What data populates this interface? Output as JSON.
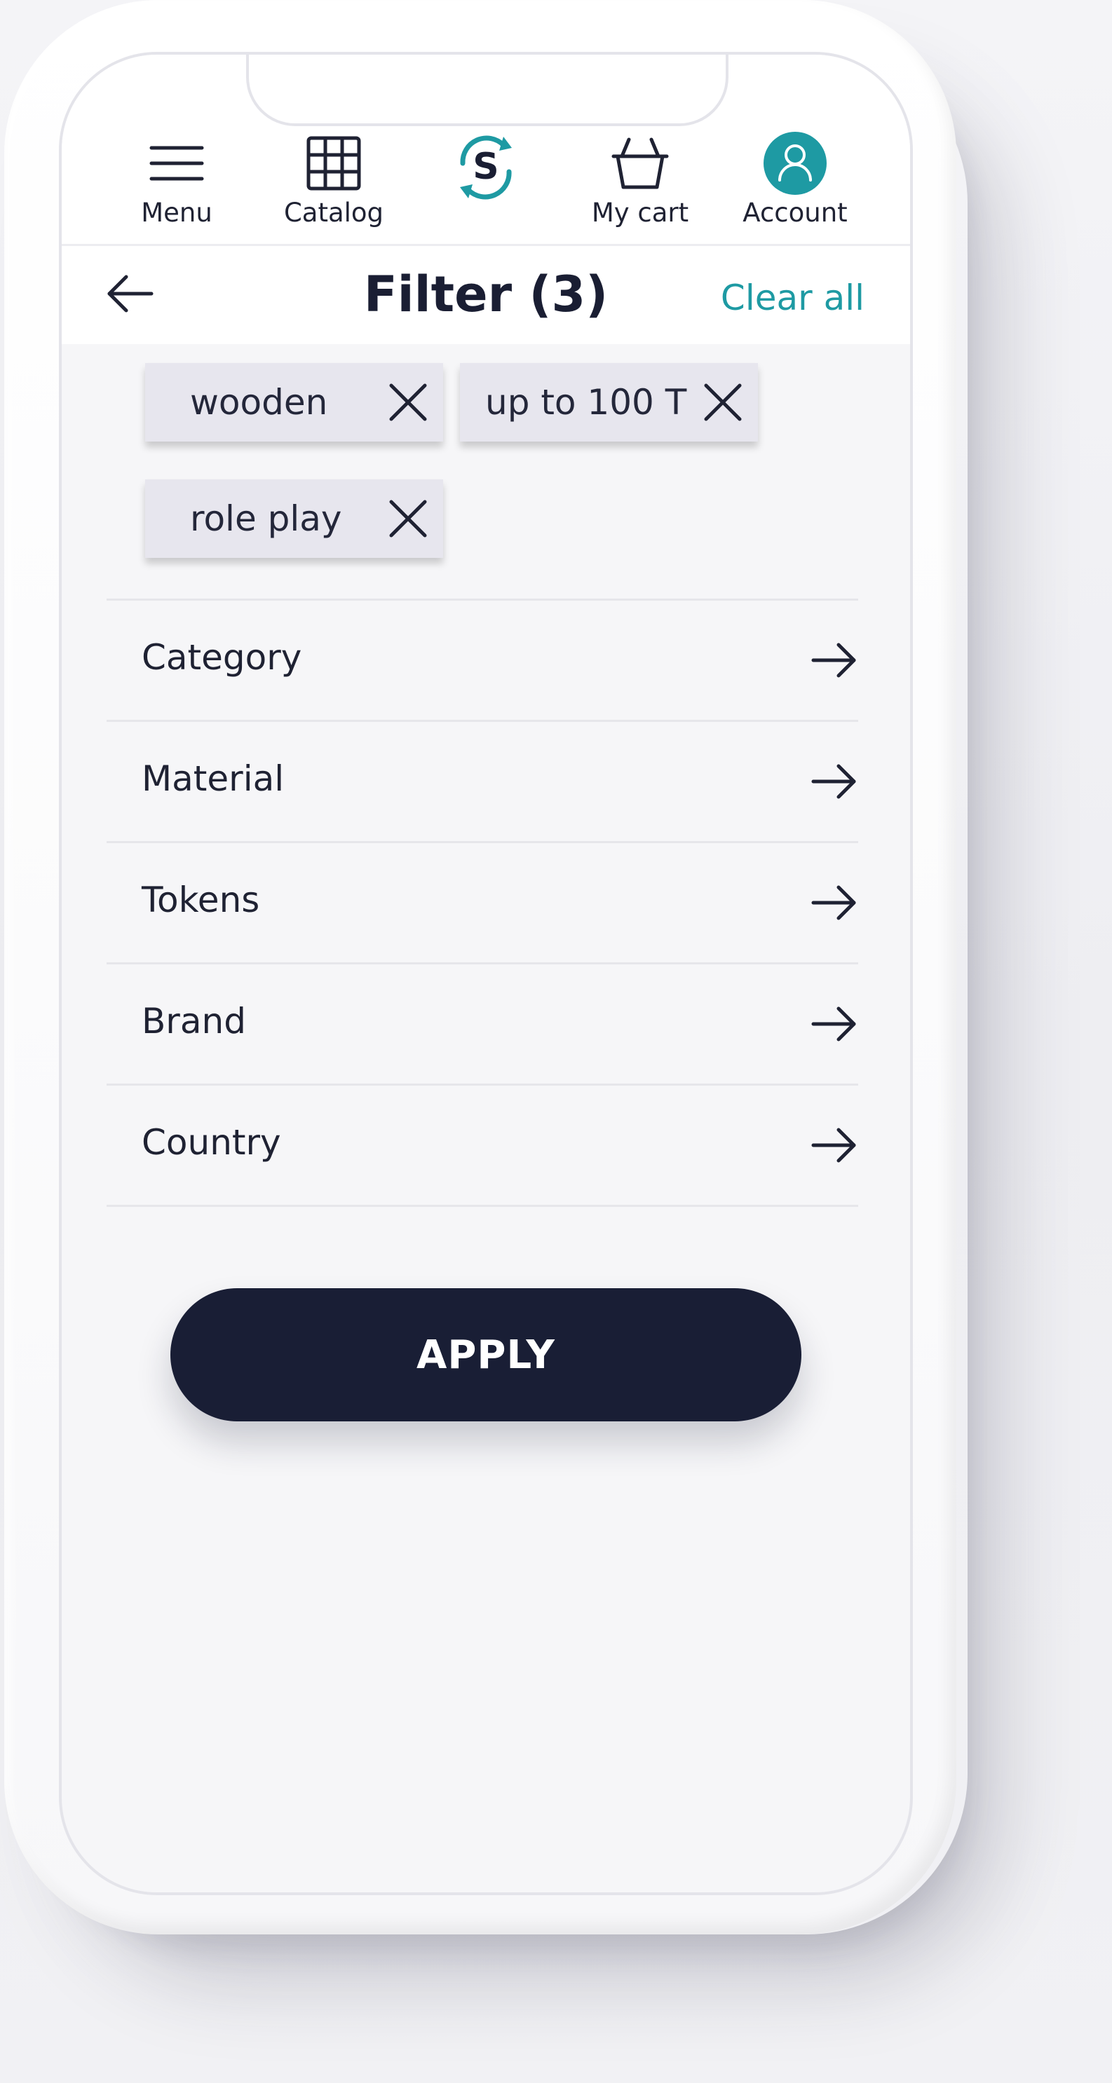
{
  "nav": {
    "menu_label": "Menu",
    "catalog_label": "Catalog",
    "logo_letter": "S",
    "cart_label": "My cart",
    "account_label": "Account"
  },
  "header": {
    "title": "Filter (3)",
    "clear_all": "Clear all"
  },
  "chips": [
    {
      "label": "wooden"
    },
    {
      "label": "up to 100 T"
    },
    {
      "label": "role play"
    }
  ],
  "filter_rows": [
    {
      "label": "Category"
    },
    {
      "label": "Material"
    },
    {
      "label": "Tokens"
    },
    {
      "label": "Brand"
    },
    {
      "label": "Country"
    }
  ],
  "apply_label": "APPLY",
  "colors": {
    "accent": "#1e9aa3",
    "dark": "#191e35",
    "chip_bg": "#e7e6ee"
  },
  "icons": {
    "menu": "hamburger-icon",
    "catalog": "grid-icon",
    "logo": "s-logo-icon",
    "cart": "basket-icon",
    "account": "user-avatar-icon",
    "back": "arrow-left-icon",
    "chip_remove": "close-icon",
    "row_nav": "arrow-right-icon"
  }
}
